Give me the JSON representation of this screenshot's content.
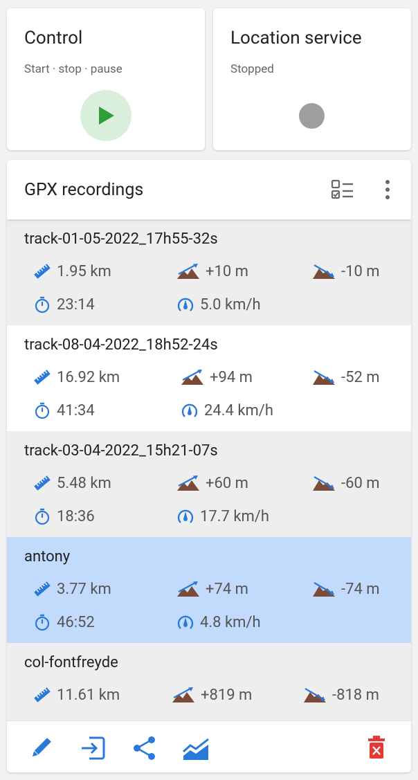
{
  "control": {
    "title": "Control",
    "subtitle": "Start · stop · pause"
  },
  "location": {
    "title": "Location service",
    "subtitle": "Stopped"
  },
  "gpx": {
    "title": "GPX recordings",
    "tracks": [
      {
        "name": "track-01-05-2022_17h55-32s",
        "distance": "1.95 km",
        "up": "+10 m",
        "down": "-10 m",
        "duration": "23:14",
        "speed": "5.0 km/h"
      },
      {
        "name": "track-08-04-2022_18h52-24s",
        "distance": "16.92 km",
        "up": "+94 m",
        "down": "-52 m",
        "duration": "41:34",
        "speed": "24.4 km/h"
      },
      {
        "name": "track-03-04-2022_15h21-07s",
        "distance": "5.48 km",
        "up": "+60 m",
        "down": "-60 m",
        "duration": "18:36",
        "speed": "17.7 km/h"
      },
      {
        "name": "antony",
        "distance": "3.77 km",
        "up": "+74 m",
        "down": "-74 m",
        "duration": "46:52",
        "speed": "4.8 km/h"
      },
      {
        "name": "col-fontfreyde",
        "distance": "11.61 km",
        "up": "+819 m",
        "down": "-818 m",
        "duration": "",
        "speed": ""
      }
    ]
  },
  "colors": {
    "accent": "#2979d8",
    "play": "#2e9d3a",
    "delete": "#e53935",
    "mountain": "#7b4a38",
    "selected": "#c2dafc"
  }
}
